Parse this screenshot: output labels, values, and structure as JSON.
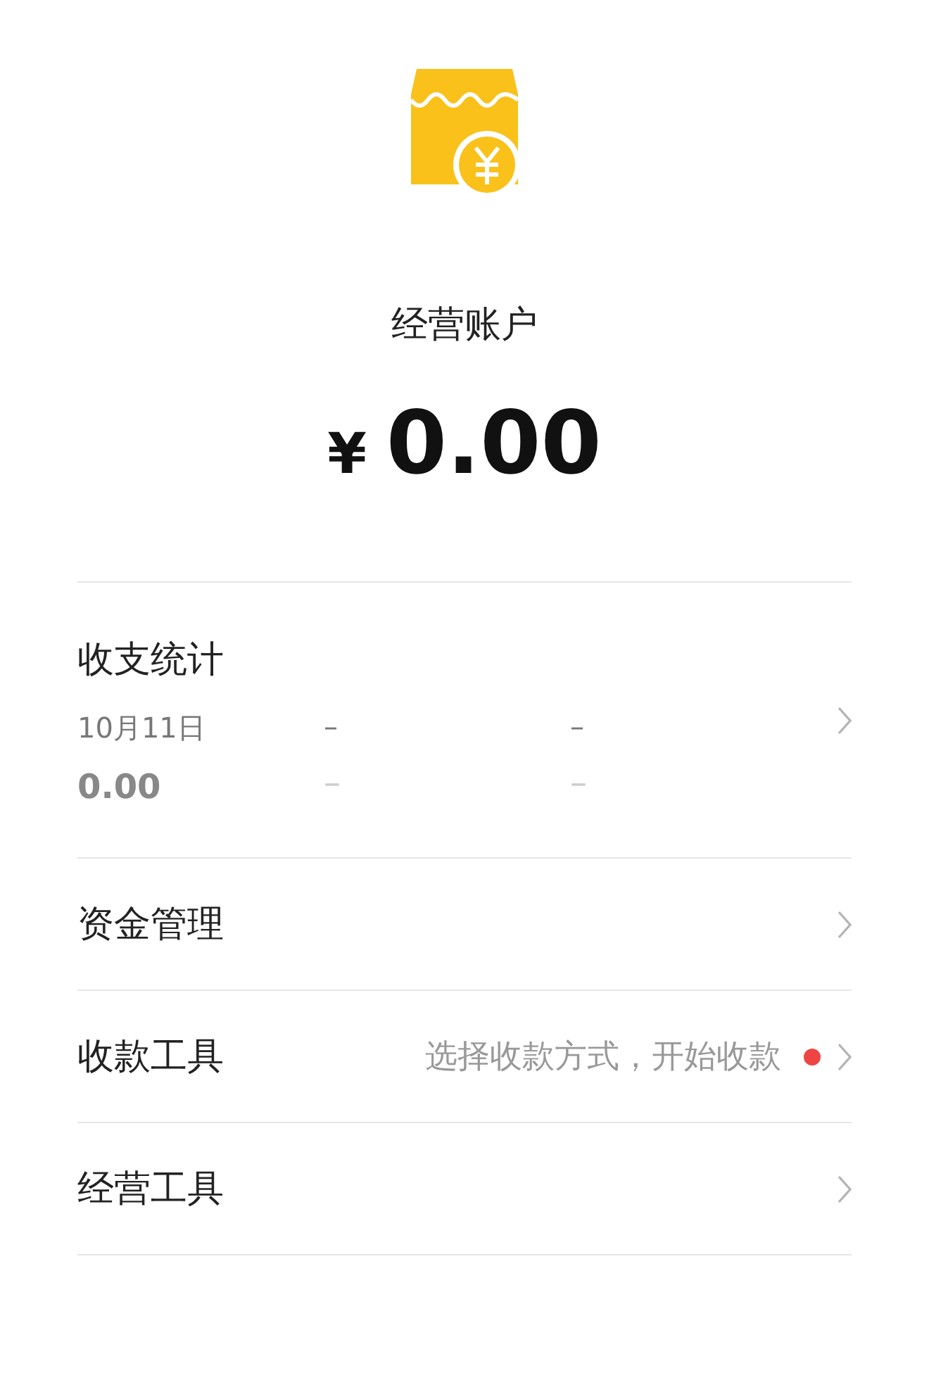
{
  "account": {
    "title": "经营账户",
    "currency": "¥",
    "amount": "0.00"
  },
  "stats": {
    "title": "收支统计",
    "columns": [
      {
        "label": "10月11日",
        "value": "0.00"
      },
      {
        "label": "–",
        "value": "–"
      },
      {
        "label": "–",
        "value": "–"
      }
    ]
  },
  "menu": [
    {
      "label": "资金管理"
    },
    {
      "label": "收款工具",
      "hint": "选择收款方式，开始收款",
      "dot": true
    },
    {
      "label": "经营工具"
    }
  ]
}
